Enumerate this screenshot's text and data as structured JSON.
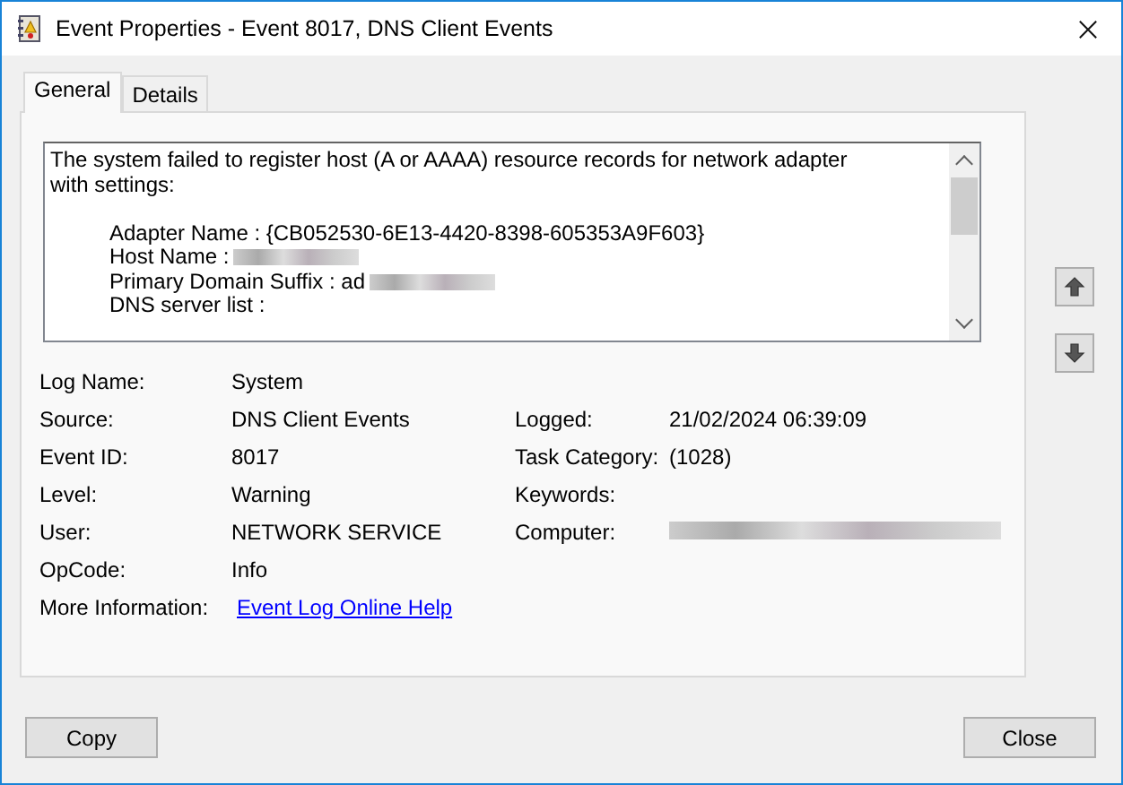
{
  "window": {
    "title": "Event Properties - Event 8017, DNS Client Events"
  },
  "tabs": [
    {
      "label": "General",
      "selected": true
    },
    {
      "label": "Details",
      "selected": false
    }
  ],
  "message": {
    "lines": [
      {
        "text": "The system failed to register host (A or AAAA) resource records for network adapter",
        "indented": false,
        "redacted": false
      },
      {
        "text": "with settings:",
        "indented": false,
        "redacted": false
      },
      {
        "text": "Adapter Name : {CB052530-6E13-4420-8398-605353A9F603}",
        "indented": true,
        "redacted": false,
        "blank_before": true
      },
      {
        "text": "Host Name :",
        "indented": true,
        "redacted": true
      },
      {
        "text": "Primary Domain Suffix : ad",
        "indented": true,
        "redacted": true
      },
      {
        "text": "DNS server list :",
        "indented": true,
        "redacted": false
      }
    ]
  },
  "properties": [
    [
      {
        "label": "Log Name:",
        "value": "System"
      }
    ],
    [
      {
        "label": "Source:",
        "value": "DNS Client Events"
      },
      {
        "label": "Logged:",
        "value": "21/02/2024 06:39:09"
      }
    ],
    [
      {
        "label": "Event ID:",
        "value": "8017"
      },
      {
        "label": "Task Category:",
        "value": "(1028)"
      }
    ],
    [
      {
        "label": "Level:",
        "value": "Warning"
      },
      {
        "label": "Keywords:"
      }
    ],
    [
      {
        "label": "User:",
        "value": "NETWORK SERVICE"
      },
      {
        "label": "Computer:",
        "redacted": true
      }
    ],
    [
      {
        "label": "OpCode:",
        "value": "Info"
      }
    ],
    [
      {
        "label": "More Information:",
        "link": "Event Log Online Help"
      }
    ]
  ],
  "buttons": [
    {
      "label": "Copy"
    },
    {
      "label": "Close"
    }
  ]
}
